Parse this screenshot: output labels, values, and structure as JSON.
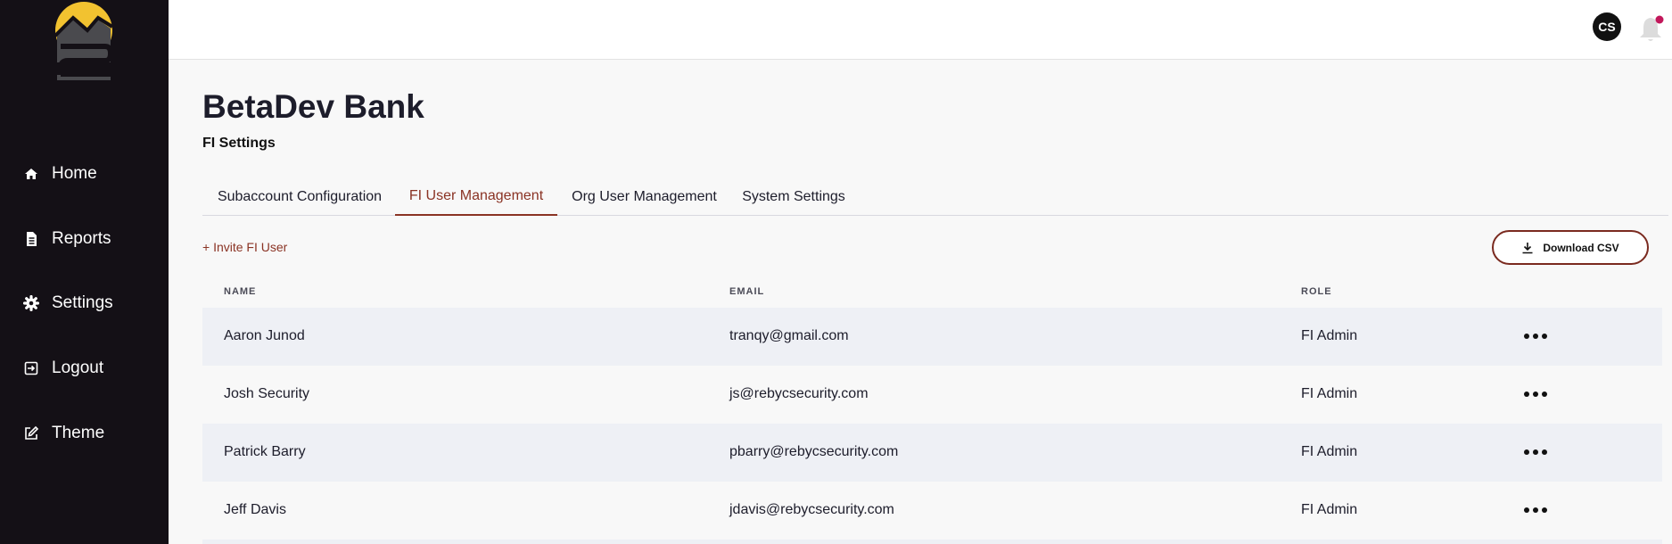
{
  "sidebar": {
    "items": [
      {
        "label": "Home",
        "icon": "home-icon"
      },
      {
        "label": "Reports",
        "icon": "document-icon"
      },
      {
        "label": "Settings",
        "icon": "gear-icon"
      },
      {
        "label": "Logout",
        "icon": "logout-icon"
      },
      {
        "label": "Theme",
        "icon": "edit-icon"
      }
    ]
  },
  "header": {
    "avatar_initials": "CS",
    "notification_color": "#c2185b"
  },
  "page": {
    "title": "BetaDev Bank",
    "subtitle": "FI Settings"
  },
  "tabs": [
    {
      "label": "Subaccount Configuration",
      "active": false
    },
    {
      "label": "FI User Management",
      "active": true
    },
    {
      "label": "Org User Management",
      "active": false
    },
    {
      "label": "System Settings",
      "active": false
    }
  ],
  "actions": {
    "invite_label": "+ Invite FI User",
    "download_label": "Download CSV"
  },
  "table": {
    "columns": [
      "NAME",
      "EMAIL",
      "ROLE"
    ],
    "rows": [
      {
        "name": "Aaron Junod",
        "email": "tranqy@gmail.com",
        "role": "FI Admin"
      },
      {
        "name": "Josh Security",
        "email": "js@rebycsecurity.com",
        "role": "FI Admin"
      },
      {
        "name": "Patrick Barry",
        "email": "pbarry@rebycsecurity.com",
        "role": "FI Admin"
      },
      {
        "name": "Jeff Davis",
        "email": "jdavis@rebycsecurity.com",
        "role": "FI Admin"
      }
    ]
  },
  "colors": {
    "sidebar_bg": "#141016",
    "accent": "#8a3324",
    "logo_yellow": "#f2c230",
    "row_shade": "#eef0f5"
  }
}
